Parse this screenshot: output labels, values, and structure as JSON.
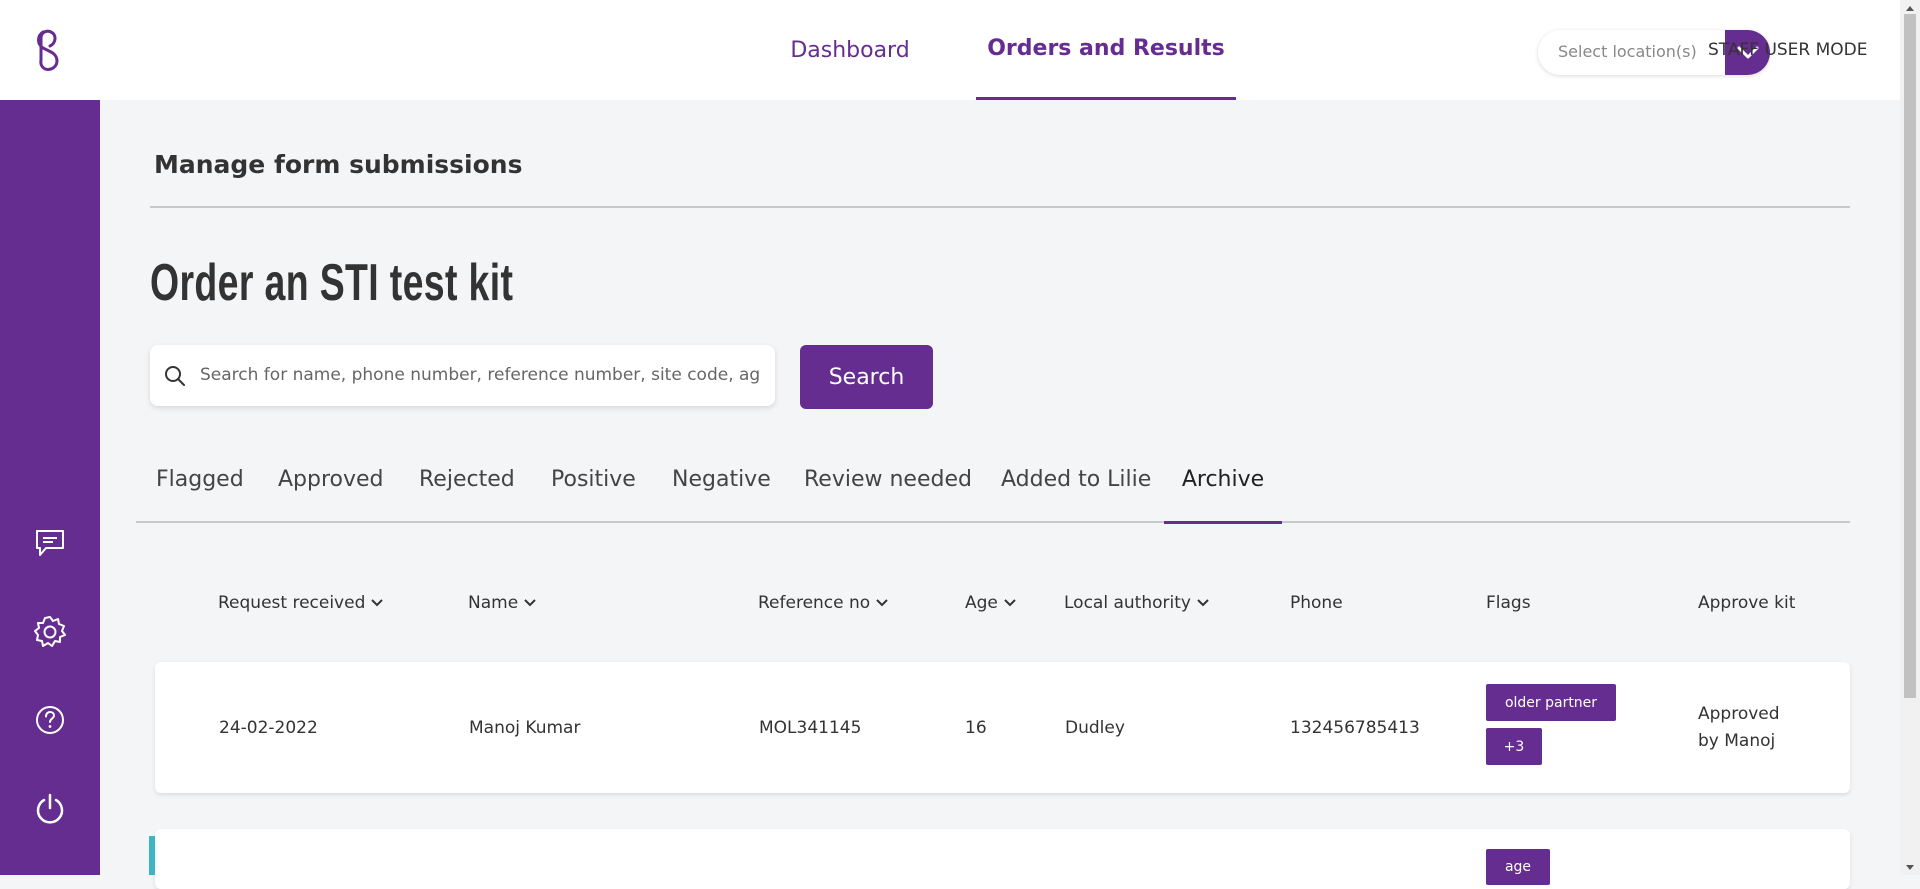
{
  "header": {
    "logo_icon": "brand-logo",
    "nav": [
      {
        "label": "Dashboard",
        "active": false
      },
      {
        "label": "Orders and Results",
        "active": true
      }
    ],
    "location_placeholder": "Select location(s)",
    "mode_label": "STAFF USER MODE"
  },
  "sidebar": {
    "icons": [
      "message-icon",
      "gear-icon",
      "help-icon",
      "power-icon"
    ]
  },
  "main": {
    "page_title": "Manage form submissions",
    "form_title": "Order an STI test kit",
    "search": {
      "placeholder": "Search for name, phone number, reference number, site code, age,...",
      "button_label": "Search"
    },
    "tabs": [
      {
        "label": "Flagged",
        "active": false
      },
      {
        "label": "Approved",
        "active": false
      },
      {
        "label": "Rejected",
        "active": false
      },
      {
        "label": "Positive",
        "active": false
      },
      {
        "label": "Negative",
        "active": false
      },
      {
        "label": "Review needed",
        "active": false
      },
      {
        "label": "Added to Lilie",
        "active": false
      },
      {
        "label": "Archive",
        "active": true
      }
    ],
    "columns": [
      {
        "label": "Request received",
        "sortable": true
      },
      {
        "label": "Name",
        "sortable": true
      },
      {
        "label": "Reference no",
        "sortable": true
      },
      {
        "label": "Age",
        "sortable": true
      },
      {
        "label": "Local authority",
        "sortable": true
      },
      {
        "label": "Phone",
        "sortable": false
      },
      {
        "label": "Flags",
        "sortable": false
      },
      {
        "label": "Approve kit",
        "sortable": false
      }
    ],
    "rows": [
      {
        "request_received": "24-02-2022",
        "name": "Manoj Kumar",
        "reference_no": "MOL341145",
        "age": "16",
        "local_authority": "Dudley",
        "phone": "132456785413",
        "flags": [
          "older partner",
          "+3"
        ],
        "approve_line1": "Approved",
        "approve_line2": "by Manoj"
      },
      {
        "flags": [
          "age"
        ],
        "accent_color": "#3cb5c4"
      }
    ]
  },
  "colors": {
    "brand": "#662d91",
    "accent_teal": "#3cb5c4",
    "background": "#f4f5f7"
  }
}
